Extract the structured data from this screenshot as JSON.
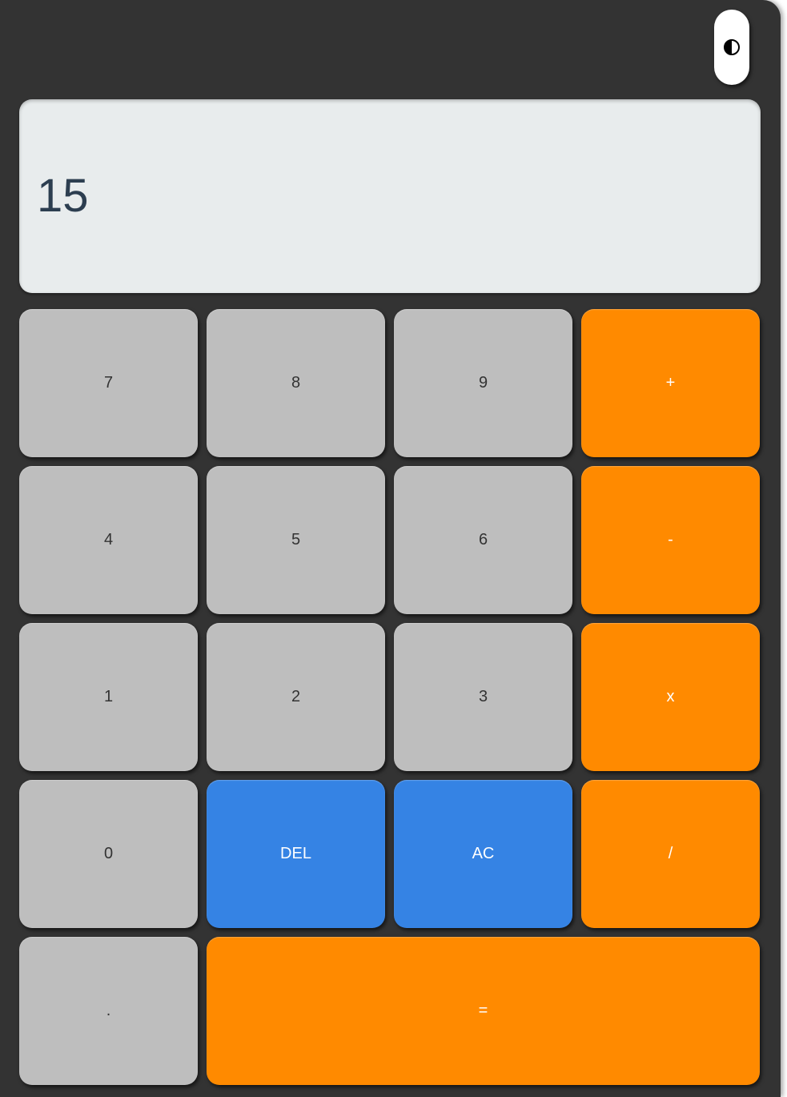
{
  "theme_toggle": {
    "icon": "contrast-icon"
  },
  "display": {
    "value": "15"
  },
  "keys": {
    "seven": "7",
    "eight": "8",
    "nine": "9",
    "plus": "+",
    "four": "4",
    "five": "5",
    "six": "6",
    "minus": "-",
    "one": "1",
    "two": "2",
    "three": "3",
    "multiply": "x",
    "zero": "0",
    "delete": "DEL",
    "clear": "AC",
    "divide": "/",
    "decimal": ".",
    "equals": "="
  },
  "colors": {
    "body": "#333333",
    "display": "#e8eced",
    "number_key": "#bebebe",
    "operator_key": "#ff8a00",
    "function_key": "#3583e4"
  }
}
